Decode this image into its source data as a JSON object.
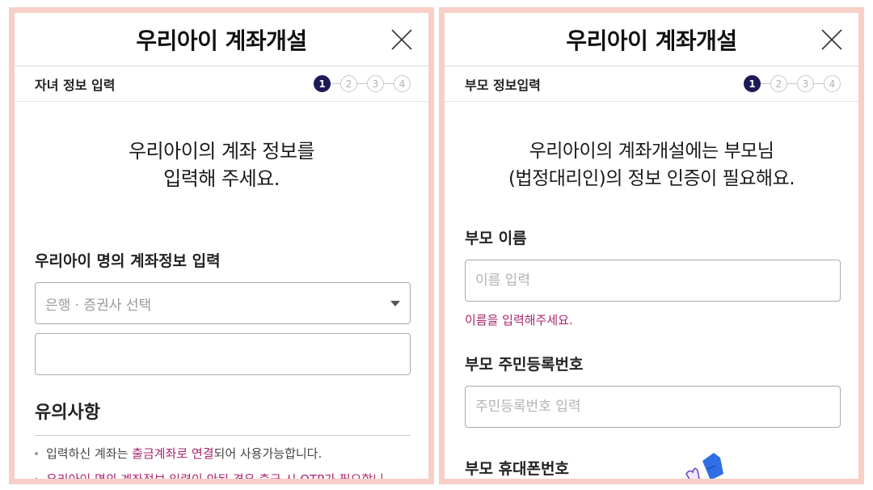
{
  "left": {
    "title": "우리아이 계좌개설",
    "step_label": "자녀 정보 입력",
    "steps": [
      "1",
      "2",
      "3",
      "4"
    ],
    "active_step": 1,
    "intro_line1": "우리아이의 계좌 정보를",
    "intro_line2": "입력해 주세요.",
    "account_label": "우리아이 명의 계좌정보 입력",
    "bank_select_placeholder": "은행 · 증권사 선택",
    "account_input_value": "",
    "notice_title": "유의사항",
    "notice1_prefix": "입력하신 계좌는 ",
    "notice1_highlight": "출금계좌로 연결",
    "notice1_suffix": "되어 사용가능합니다.",
    "notice2": "우리아이 명의 계좌정보 입력이 안된 경우 출금 시 OTP가 필요합니"
  },
  "right": {
    "title": "우리아이 계좌개설",
    "step_label": "부모 정보입력",
    "steps": [
      "1",
      "2",
      "3",
      "4"
    ],
    "active_step": 1,
    "intro_line1": "우리아이의 계좌개설에는 부모님",
    "intro_line2": "(법정대리인)의 정보 인증이 필요해요.",
    "name_label": "부모 이름",
    "name_placeholder": "이름 입력",
    "name_error": "이름을 입력해주세요.",
    "rrn_label": "부모 주민등록번호",
    "rrn_placeholder": "주민등록번호 입력",
    "phone_label": "부모 휴대폰번호"
  },
  "icons": {
    "close": "close-icon",
    "dropdown": "chevron-down-icon",
    "pointer": "hand-pointer-icon"
  },
  "colors": {
    "frame": "#f7cfc7",
    "active_step": "#1d1a58",
    "highlight": "#a8246d",
    "pointer_blue": "#2f6fe6"
  }
}
